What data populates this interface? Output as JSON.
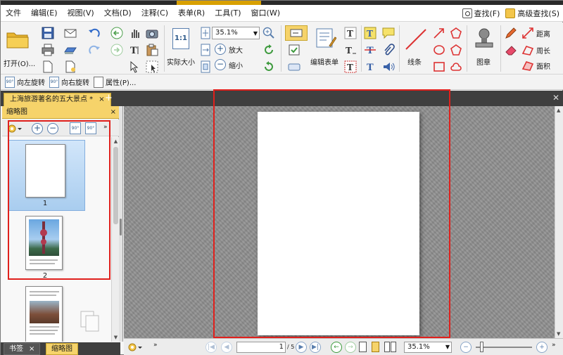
{
  "menu": [
    "文件",
    "编辑(E)",
    "视图(V)",
    "文档(D)",
    "注释(C)",
    "表单(R)",
    "工具(T)",
    "窗口(W)"
  ],
  "search": {
    "find_label": "查找(F)",
    "advanced_label": "高级查找(S)"
  },
  "ribbon": {
    "open_label": "打开(O)...",
    "actual_size_label": "实际大小",
    "actual_size_icon_text": "1:1",
    "zoom_value": "35.1%",
    "zoom_in_label": "放大",
    "zoom_out_label": "缩小",
    "edit_form_label": "编辑表单",
    "line_label": "线条",
    "stamp_label": "图章",
    "distance_label": "距离",
    "perimeter_label": "周长",
    "area_label": "面积"
  },
  "rotate": {
    "left_label": "向左旋转",
    "right_label": "向右旋转",
    "properties_label": "属性(P)...",
    "icon_text": "90°"
  },
  "document_tab": {
    "title": "上海旅游著名的五大景点 *",
    "close": "×"
  },
  "thumbnails": {
    "panel_title": "缩略图",
    "page_numbers": [
      "1",
      "2"
    ]
  },
  "bottom_tabs": {
    "bookmarks": "书签",
    "thumbnails": "缩略图"
  },
  "status": {
    "page_value": "1",
    "page_total": "/ 5",
    "zoom_value": "35.1%"
  },
  "colors": {
    "accent_yellow": "#f6d36a",
    "highlight_red": "#e0201c",
    "selection_blue": "#a9cdef"
  }
}
